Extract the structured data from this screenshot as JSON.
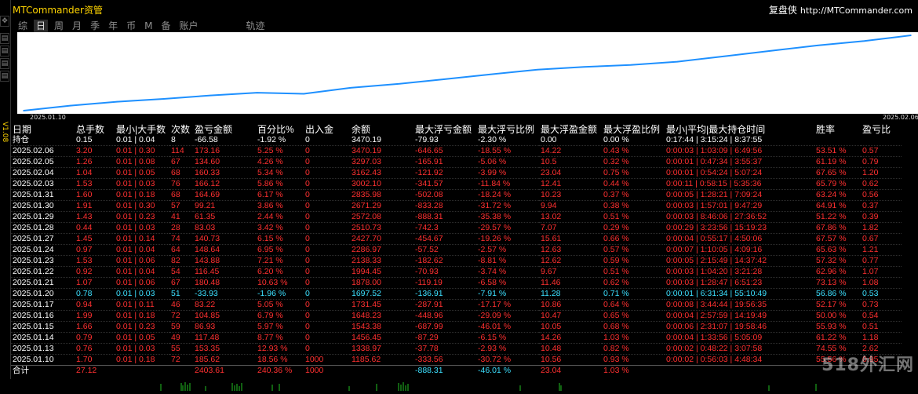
{
  "window_title": "MTCommander资管",
  "brand": {
    "name": "复盘侠",
    "url": "http://MTCommander.com"
  },
  "side_label": "V1.08",
  "tabs": [
    "综",
    "日",
    "周",
    "月",
    "季",
    "年",
    "币",
    "M",
    "备",
    "账户"
  ],
  "active_tab": 1,
  "track_label": "轨迹",
  "chart_data": {
    "type": "line",
    "x_start_label": "2025.01.10",
    "x_end_label": "2025.02.06",
    "series_color": "#1e90ff",
    "x": [
      "2025.01.10",
      "2025.01.13",
      "2025.01.14",
      "2025.01.15",
      "2025.01.16",
      "2025.01.17",
      "2025.01.20",
      "2025.01.21",
      "2025.01.22",
      "2025.01.23",
      "2025.01.24",
      "2025.01.27",
      "2025.01.28",
      "2025.01.29",
      "2025.01.30",
      "2025.01.31",
      "2025.02.03",
      "2025.02.04",
      "2025.02.05",
      "2025.02.06"
    ],
    "values": [
      1185.62,
      1338.97,
      1456.45,
      1543.38,
      1648.23,
      1731.45,
      1697.52,
      1878.0,
      1994.45,
      2138.33,
      2286.97,
      2427.7,
      2510.73,
      2572.08,
      2671.29,
      2835.98,
      3002.1,
      3162.43,
      3297.03,
      3470.19
    ]
  },
  "headers": [
    "日期",
    "总手数",
    "最小|大手数",
    "次数",
    "盈亏金额",
    "百分比%",
    "出入金",
    "余额",
    "最大浮亏金额",
    "最大浮亏比例",
    "最大浮盈金额",
    "最大浮盈比例",
    "最小|平均|最大持仓时间",
    "胜率",
    "盈亏比"
  ],
  "holding": [
    "持仓",
    "0.15",
    "0.01 | 0.04",
    "8",
    "-66.58",
    "-1.92 %",
    "0",
    "3470.19",
    "-79.93",
    "-2.30 %",
    "0.00",
    "0.00 %",
    "0:17:44 | 3:15:24 | 8:37:55",
    "",
    ""
  ],
  "rows": [
    {
      "c": "r",
      "v": [
        "2025.02.06",
        "3.20",
        "0.01 | 0.30",
        "114",
        "173.16",
        "5.25 %",
        "0",
        "3470.19",
        "-646.65",
        "-18.55 %",
        "14.22",
        "0.43 %",
        "0:00:03 | 1:03:09 | 6:49:56",
        "53.51 %",
        "0.57"
      ]
    },
    {
      "c": "r",
      "v": [
        "2025.02.05",
        "1.26",
        "0.01 | 0.08",
        "67",
        "134.60",
        "4.26 %",
        "0",
        "3297.03",
        "-165.91",
        "-5.06 %",
        "10.5",
        "0.32 %",
        "0:00:01 | 0:47:34 | 3:55:37",
        "61.19 %",
        "0.79"
      ]
    },
    {
      "c": "r",
      "v": [
        "2025.02.04",
        "1.04",
        "0.01 | 0.05",
        "68",
        "160.33",
        "5.34 %",
        "0",
        "3162.43",
        "-121.92",
        "-3.99 %",
        "23.04",
        "0.75 %",
        "0:00:01 | 0:54:24 | 5:07:24",
        "67.65 %",
        "1.20"
      ]
    },
    {
      "c": "r",
      "v": [
        "2025.02.03",
        "1.53",
        "0.01 | 0.03",
        "76",
        "166.12",
        "5.86 %",
        "0",
        "3002.10",
        "-341.57",
        "-11.84 %",
        "12.41",
        "0.44 %",
        "0:00:11 | 0:58:15 | 5:35:36",
        "65.79 %",
        "0.62"
      ]
    },
    {
      "c": "r",
      "v": [
        "2025.01.31",
        "1.60",
        "0.01 | 0.18",
        "68",
        "164.69",
        "6.17 %",
        "0",
        "2835.98",
        "-502.08",
        "-18.24 %",
        "10.23",
        "0.37 %",
        "0:00:05 | 1:28:21 | 7:09:24",
        "63.24 %",
        "0.56"
      ]
    },
    {
      "c": "r",
      "v": [
        "2025.01.30",
        "1.91",
        "0.01 | 0.30",
        "57",
        "99.21",
        "3.86 %",
        "0",
        "2671.29",
        "-833.28",
        "-31.72 %",
        "9.94",
        "0.38 %",
        "0:00:03 | 1:57:01 | 9:47:29",
        "64.91 %",
        "0.37"
      ]
    },
    {
      "c": "r",
      "v": [
        "2025.01.29",
        "1.43",
        "0.01 | 0.23",
        "41",
        "61.35",
        "2.44 %",
        "0",
        "2572.08",
        "-888.31",
        "-35.38 %",
        "13.02",
        "0.51 %",
        "0:00:03 | 8:46:06 | 27:36:52",
        "51.22 %",
        "0.39"
      ]
    },
    {
      "c": "r",
      "v": [
        "2025.01.28",
        "0.44",
        "0.01 | 0.03",
        "28",
        "83.03",
        "3.42 %",
        "0",
        "2510.73",
        "-742.3",
        "-29.57 %",
        "7.07",
        "0.29 %",
        "0:00:29 | 3:23:56 | 15:19:23",
        "67.86 %",
        "1.82"
      ]
    },
    {
      "c": "r",
      "v": [
        "2025.01.27",
        "1.45",
        "0.01 | 0.14",
        "74",
        "140.73",
        "6.15 %",
        "0",
        "2427.70",
        "-454.67",
        "-19.26 %",
        "15.61",
        "0.66 %",
        "0:00:04 | 0:55:17 | 4:50:06",
        "67.57 %",
        "0.67"
      ]
    },
    {
      "c": "r",
      "v": [
        "2025.01.24",
        "0.97",
        "0.01 | 0.04",
        "64",
        "148.64",
        "6.95 %",
        "0",
        "2286.97",
        "-57.52",
        "-2.57 %",
        "12.63",
        "0.57 %",
        "0:00:07 | 1:10:05 | 4:09:16",
        "65.63 %",
        "1.21"
      ]
    },
    {
      "c": "r",
      "v": [
        "2025.01.23",
        "1.53",
        "0.01 | 0.06",
        "82",
        "143.88",
        "7.21 %",
        "0",
        "2138.33",
        "-182.62",
        "-8.81 %",
        "12.62",
        "0.59 %",
        "0:00:05 | 2:15:49 | 14:37:42",
        "57.32 %",
        "0.77"
      ]
    },
    {
      "c": "r",
      "v": [
        "2025.01.22",
        "0.92",
        "0.01 | 0.04",
        "54",
        "116.45",
        "6.20 %",
        "0",
        "1994.45",
        "-70.93",
        "-3.74 %",
        "9.67",
        "0.51 %",
        "0:00:03 | 1:04:20 | 3:21:28",
        "62.96 %",
        "1.07"
      ]
    },
    {
      "c": "r",
      "v": [
        "2025.01.21",
        "1.07",
        "0.01 | 0.06",
        "67",
        "180.48",
        "10.63 %",
        "0",
        "1878.00",
        "-119.19",
        "-6.58 %",
        "11.46",
        "0.62 %",
        "0:00:03 | 1:28:47 | 6:51:23",
        "73.13 %",
        "1.08"
      ]
    },
    {
      "c": "b",
      "v": [
        "2025.01.20",
        "0.78",
        "0.01 | 0.03",
        "51",
        "-33.93",
        "-1.96 %",
        "0",
        "1697.52",
        "-136.91",
        "-7.91 %",
        "11.28",
        "0.71 %",
        "0:00:01 | 6:31:34 | 55:10:49",
        "56.86 %",
        "0.53"
      ]
    },
    {
      "c": "r",
      "v": [
        "2025.01.17",
        "0.94",
        "0.01 | 0.11",
        "46",
        "83.22",
        "5.05 %",
        "0",
        "1731.45",
        "-287.91",
        "-17.17 %",
        "10.86",
        "0.64 %",
        "0:00:08 | 3:44:44 | 19:56:35",
        "52.17 %",
        "0.73"
      ]
    },
    {
      "c": "r",
      "v": [
        "2025.01.16",
        "1.99",
        "0.01 | 0.18",
        "72",
        "104.85",
        "6.79 %",
        "0",
        "1648.23",
        "-448.96",
        "-29.09 %",
        "10.47",
        "0.65 %",
        "0:00:04 | 2:57:59 | 14:19:49",
        "50.00 %",
        "0.54"
      ]
    },
    {
      "c": "r",
      "v": [
        "2025.01.15",
        "1.66",
        "0.01 | 0.23",
        "59",
        "86.93",
        "5.97 %",
        "0",
        "1543.38",
        "-687.99",
        "-46.01 %",
        "10.05",
        "0.68 %",
        "0:00:06 | 2:31:07 | 19:58:46",
        "55.93 %",
        "0.51"
      ]
    },
    {
      "c": "r",
      "v": [
        "2025.01.14",
        "0.79",
        "0.01 | 0.05",
        "49",
        "117.48",
        "8.77 %",
        "0",
        "1456.45",
        "-87.29",
        "-6.15 %",
        "14.26",
        "1.03 %",
        "0:00:04 | 1:33:56 | 5:05:09",
        "61.22 %",
        "1.18"
      ]
    },
    {
      "c": "r",
      "v": [
        "2025.01.13",
        "0.76",
        "0.01 | 0.03",
        "55",
        "153.35",
        "12.93 %",
        "0",
        "1338.97",
        "-37.78",
        "-2.93 %",
        "10.48",
        "0.82 %",
        "0:00:02 | 0:48:22 | 3:07:58",
        "74.55 %",
        "2.62"
      ]
    },
    {
      "c": "r",
      "v": [
        "2025.01.10",
        "1.70",
        "0.01 | 0.18",
        "72",
        "185.62",
        "18.56 %",
        "1000",
        "1185.62",
        "-333.56",
        "-30.72 %",
        "10.56",
        "0.93 %",
        "0:00:02 | 0:56:03 | 4:48:34",
        "55.56 %",
        "0.95"
      ]
    }
  ],
  "summary": [
    "合计",
    "27.12",
    "",
    "",
    "2403.61",
    "240.36 %",
    "1000",
    "",
    "-888.31",
    "-46.01 %",
    "23.04",
    "1.03 %",
    "",
    "",
    ""
  ],
  "watermark": "518外汇网"
}
